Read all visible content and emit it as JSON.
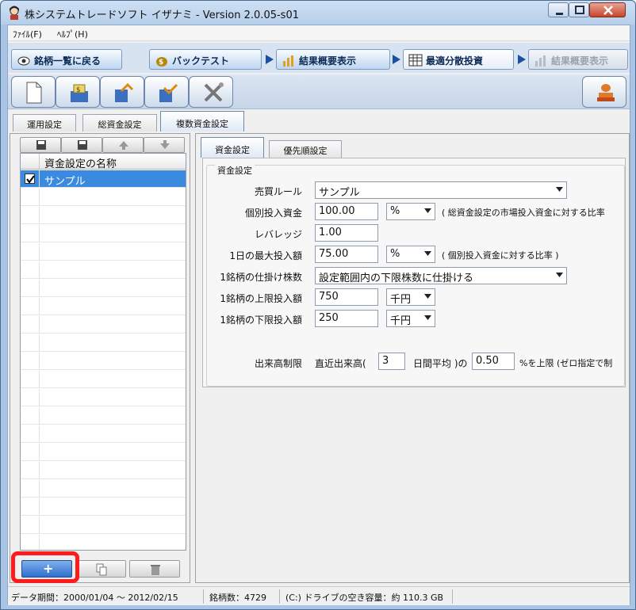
{
  "window": {
    "title": "株システムトレードソフト イザナミ - Version 2.0.05-s01"
  },
  "menu": {
    "items": [
      "ﾌｧｲﾙ(F)",
      "ﾍﾙﾌﾟ(H)"
    ]
  },
  "steps": [
    {
      "label": "銘柄一覧に戻る",
      "state": "normal",
      "icon": "eye-icon"
    },
    {
      "label": "バックテスト",
      "state": "normal",
      "icon": "bag-icon"
    },
    {
      "label": "結果概要表示",
      "state": "normal",
      "icon": "chart-icon"
    },
    {
      "label": "最適分散投資",
      "state": "active",
      "icon": "grid-icon"
    },
    {
      "label": "結果概要表示",
      "state": "disabled",
      "icon": "chart-icon"
    }
  ],
  "toolbar": {
    "icons": [
      "new-document-icon",
      "money-icon",
      "export-icon",
      "import-icon",
      "tools-icon",
      "stamp-icon"
    ]
  },
  "top_tabs": [
    {
      "label": "運用設定",
      "active": false
    },
    {
      "label": "総資金設定",
      "active": false
    },
    {
      "label": "複数資金設定",
      "active": true
    }
  ],
  "left_panel": {
    "grid_header": "資金設定の名称",
    "rows": [
      {
        "name": "サンプル",
        "checked": true,
        "selected": true
      }
    ],
    "bottom_add_label": "+"
  },
  "right_tabs": [
    {
      "label": "資金設定",
      "active": true
    },
    {
      "label": "優先順設定",
      "active": false
    }
  ],
  "settings": {
    "group_title": "資金設定",
    "buy_sell_rule": {
      "label": "売買ルール",
      "value": "サンプル"
    },
    "individual_invest": {
      "label": "個別投入資金",
      "value": "100.00",
      "unit": "%",
      "note": "( 総資金設定の市場投入資金に対する比率"
    },
    "leverage": {
      "label": "レバレッジ",
      "value": "1.00"
    },
    "daily_max": {
      "label": "1日の最大投入額",
      "value": "75.00",
      "unit": "%",
      "note": "( 個別投入資金に対する比率 )"
    },
    "shares_per_stock": {
      "label": "1銘柄の仕掛け株数",
      "value": "設定範囲内の下限株数に仕掛ける"
    },
    "upper_limit": {
      "label": "1銘柄の上限投入額",
      "value": "750",
      "unit": "千円"
    },
    "lower_limit": {
      "label": "1銘柄の下限投入額",
      "value": "250",
      "unit": "千円"
    },
    "volume_limit": {
      "label": "出来高制限",
      "prefix": "直近出来高(",
      "days": "3",
      "mid": "日間平均 )の",
      "ratio": "0.50",
      "suffix": "%を上限 (ゼロ指定で制"
    }
  },
  "status": {
    "period": "データ期間：2000/01/04 ～ 2012/02/15",
    "count": "銘柄数：4729",
    "disk": "(C:) ドライブの空き容量：約 110.3 GB"
  }
}
